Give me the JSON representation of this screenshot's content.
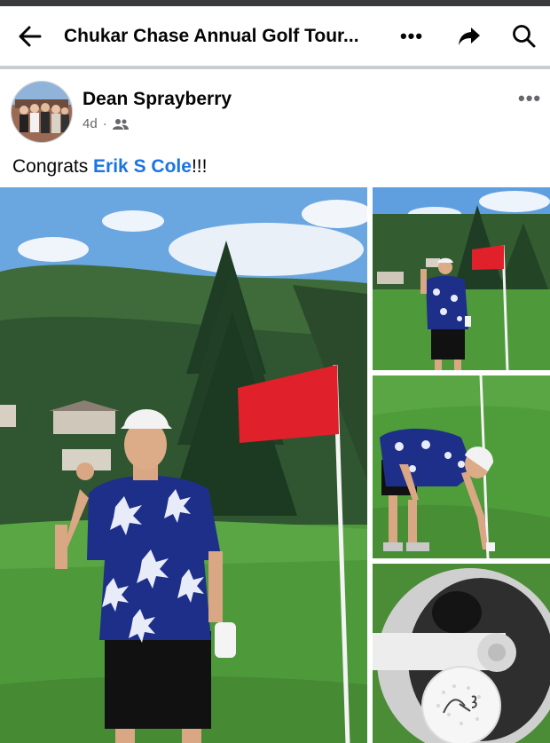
{
  "header": {
    "title": "Chukar Chase Annual Golf Tour...",
    "back_icon": "arrow-left-icon",
    "more_label": "•••",
    "share_icon": "share-arrow-icon",
    "search_icon": "search-icon"
  },
  "post": {
    "author": "Dean Sprayberry",
    "time": "4d",
    "separator": "·",
    "audience_icon": "friends-icon",
    "more_label": "•••",
    "caption_prefix": "Congrats ",
    "caption_mention": "Erik S Cole",
    "caption_suffix": "!!!"
  },
  "colors": {
    "mention": "#1b74e4",
    "sky": "#6aa6e0",
    "grass": "#4e9a3a",
    "flag": "#e0202a"
  }
}
